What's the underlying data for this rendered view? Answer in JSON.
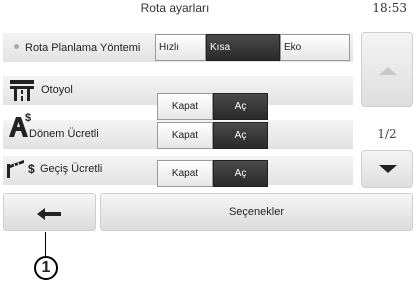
{
  "header": {
    "title": "Rota ayarları",
    "clock": "18:53"
  },
  "rows": [
    {
      "label": "Rota Planlama Yöntemi",
      "options": [
        "Hızlı",
        "Kısa",
        "Eko"
      ],
      "selected": "Kısa"
    },
    {
      "label": "Otoyol",
      "off": "Kapat",
      "on": "Aç",
      "selected": "Aç"
    },
    {
      "label": "Dönem Ücretli",
      "off": "Kapat",
      "on": "Aç",
      "selected": "Aç"
    },
    {
      "label": "Geçiş Ücretli",
      "off": "Kapat",
      "on": "Aç",
      "selected": "Aç"
    }
  ],
  "pager": {
    "page": "1/2"
  },
  "footer": {
    "options_label": "Seçenekler"
  },
  "callout": {
    "number": "1"
  },
  "colors": {
    "selected": "#333333",
    "panel": "#e8e8e8"
  }
}
